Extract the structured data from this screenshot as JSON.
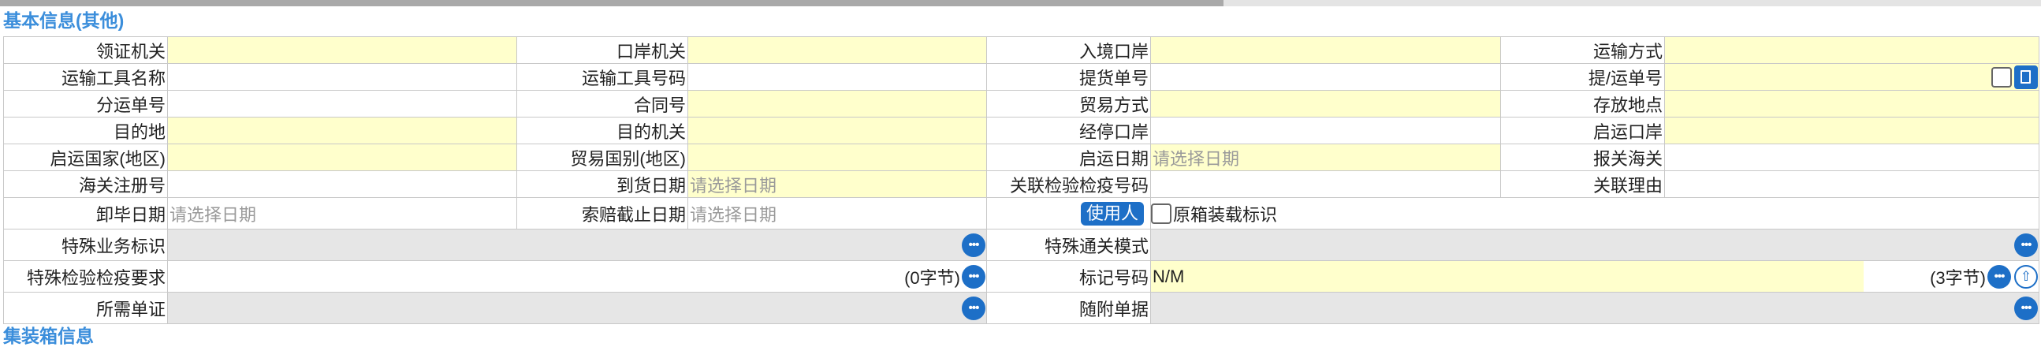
{
  "section_title": "基本信息(其他)",
  "next_section_title": "集装箱信息",
  "labels": {
    "issuing_authority": "领证机关",
    "port_authority": "口岸机关",
    "entry_port": "入境口岸",
    "transport_mode": "运输方式",
    "vehicle_name": "运输工具名称",
    "vehicle_number": "运输工具号码",
    "bill_of_lading": "提货单号",
    "transport_bill": "提/运单号",
    "sub_bill": "分运单号",
    "contract_no": "合同号",
    "trade_mode": "贸易方式",
    "storage_place": "存放地点",
    "destination": "目的地",
    "destination_authority": "目的机关",
    "stopover_port": "经停口岸",
    "departure_port": "启运口岸",
    "departure_country": "启运国家(地区)",
    "trade_country": "贸易国别(地区)",
    "departure_date": "启运日期",
    "customs": "报关海关",
    "customs_reg_no": "海关注册号",
    "arrival_date": "到货日期",
    "related_inspection_no": "关联检验检疫号码",
    "related_reason": "关联理由",
    "unload_date": "卸毕日期",
    "claim_deadline": "索赔截止日期",
    "use_person_button": "使用人",
    "original_container_label": "原箱装载标识",
    "special_business_flag": "特殊业务标识",
    "special_clearance_mode": "特殊通关模式",
    "special_inspection_req": "特殊检验检疫要求",
    "marks_no": "标记号码",
    "required_certificates": "所需单证",
    "attached_documents": "随附单据"
  },
  "placeholders": {
    "date": "请选择日期"
  },
  "values": {
    "marks_no": "N/M",
    "special_inspection_bytes": "(0字节)",
    "marks_no_bytes": "(3字节)"
  },
  "icons": {
    "more": "more-icon",
    "upload": "upload-icon",
    "document": "document-icon"
  },
  "colors": {
    "required_bg": "#ffffcc",
    "readonly_bg": "#e6e6e6",
    "accent": "#1d6fc7",
    "section_title": "#3b8edb"
  }
}
